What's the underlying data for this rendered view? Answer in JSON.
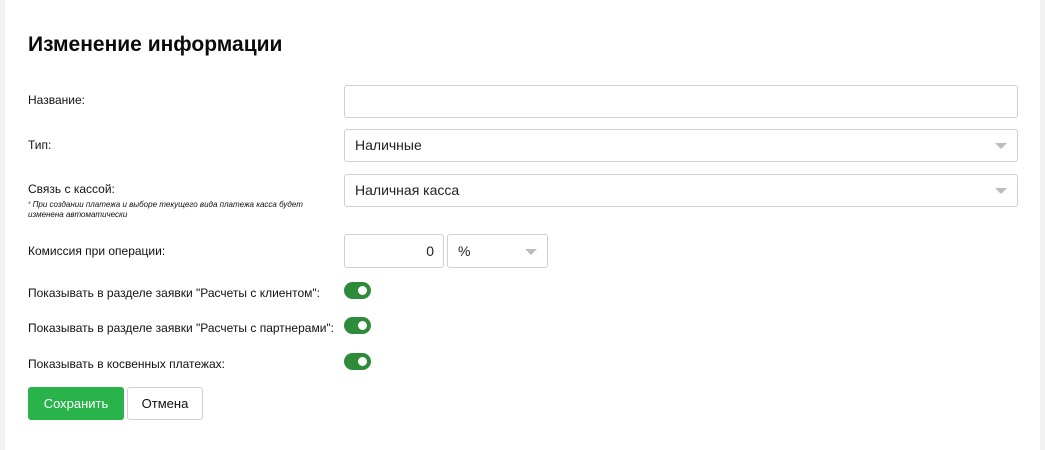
{
  "form": {
    "title": "Изменение информации",
    "name": {
      "label": "Название:",
      "value": "",
      "placeholder": ""
    },
    "type": {
      "label": "Тип:",
      "value": "Наличные",
      "icon": "chevron-down-icon"
    },
    "cashbox": {
      "label": "Связь с кассой:",
      "note_marker": "*",
      "note": "При создании платежа и выборе текущего вида платежа касса будет изменена автоматически",
      "value": "Наличная касса",
      "icon": "chevron-down-icon"
    },
    "commission": {
      "label": "Комиссия при операции:",
      "value": "0",
      "unit": "%"
    },
    "toggles": [
      {
        "label": "Показывать в разделе заявки \"Расчеты с клиентом\":",
        "on": true
      },
      {
        "label": "Показывать в разделе заявки \"Расчеты с партнерами\":",
        "on": true
      },
      {
        "label": "Показывать в косвенных платежах:",
        "on": true
      }
    ],
    "buttons": {
      "save": "Сохранить",
      "cancel": "Отмена"
    }
  },
  "colors": {
    "save_button": "#29b34b",
    "toggle_on": "#2e8b3a",
    "border": "#cfcfcf",
    "background": "#f2f2f2"
  }
}
